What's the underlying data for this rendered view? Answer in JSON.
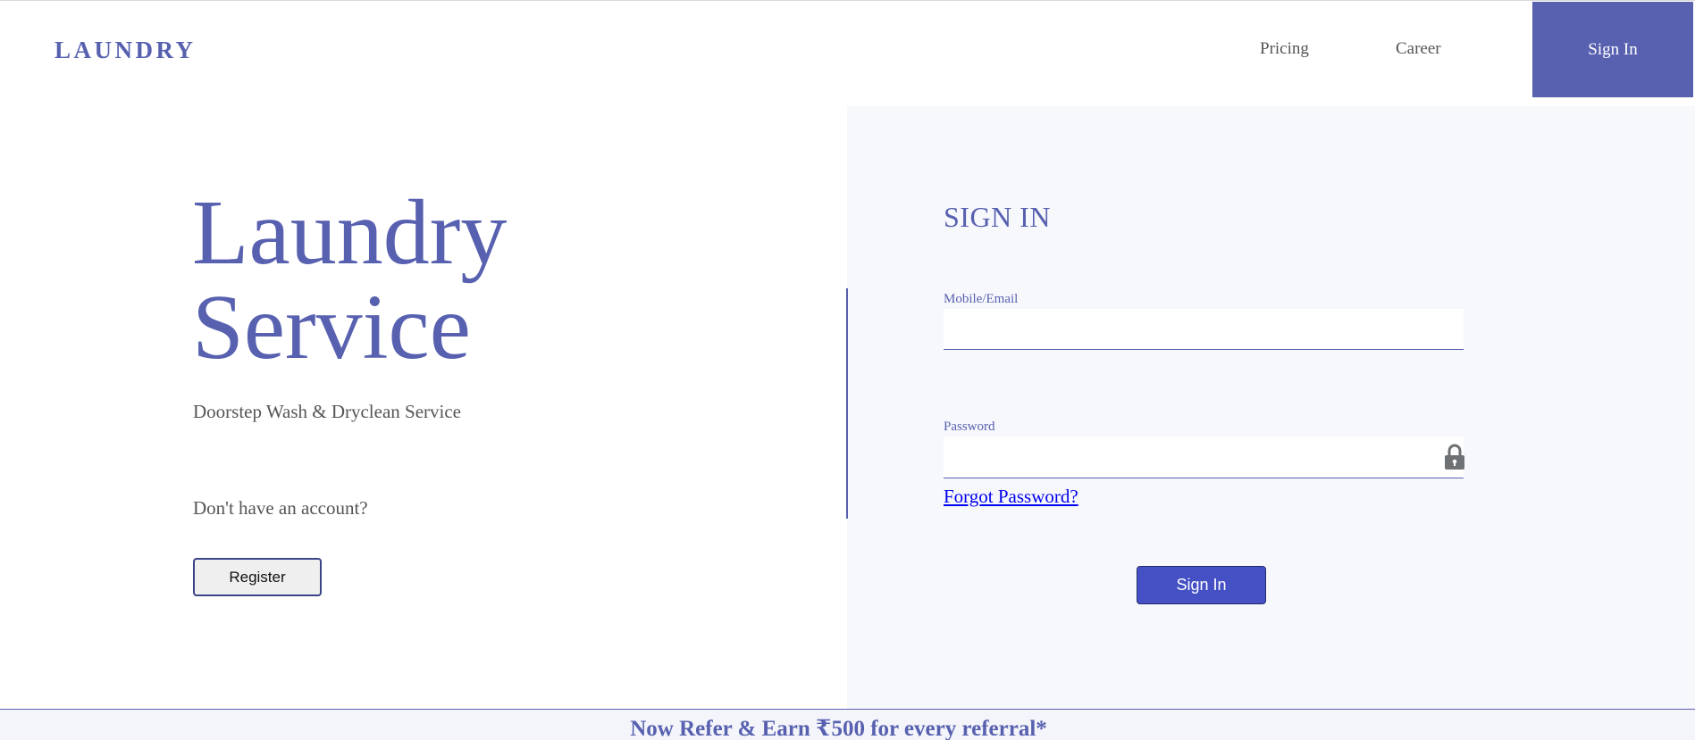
{
  "header": {
    "logo": "LAUNDRY",
    "nav": {
      "pricing": "Pricing",
      "career": "Career",
      "sign_in": "Sign In"
    }
  },
  "hero": {
    "title_line1": "Laundry",
    "title_line2": "Service",
    "subtitle": "Doorstep Wash & Dryclean Service",
    "no_account_text": "Don't have an account?",
    "register_label": "Register"
  },
  "signin_form": {
    "title": "SIGN IN",
    "mobile_label": "Mobile/Email",
    "mobile_value": "",
    "password_label": "Password",
    "password_value": "",
    "password_icon": "lock-icon",
    "forgot_label": "Forgot Password?",
    "submit_label": "Sign In"
  },
  "footer": {
    "banner_text": "Now Refer & Earn ₹500 for every referral*"
  },
  "colors": {
    "brand": "#5861b0",
    "button": "#4450c4",
    "panel_bg": "#f7f8fc",
    "link": "#0000ee"
  }
}
